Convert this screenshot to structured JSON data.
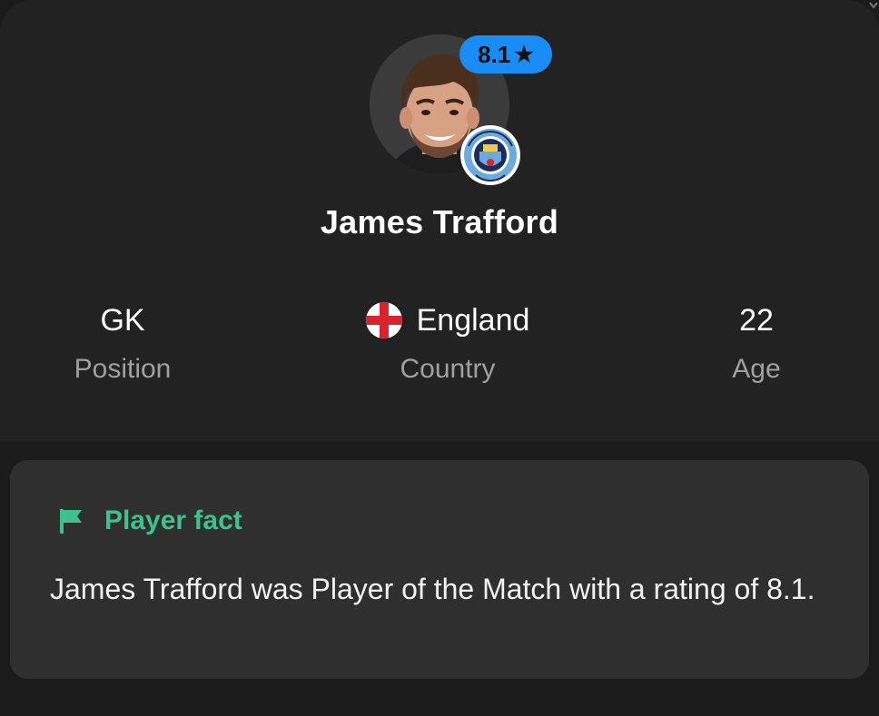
{
  "player": {
    "name": "James Trafford",
    "rating": "8.1",
    "club_badge_icon": "manchester-city-crest"
  },
  "stats": {
    "position": {
      "value": "GK",
      "label": "Position"
    },
    "country": {
      "value": "England",
      "label": "Country",
      "flag_icon": "england-flag"
    },
    "age": {
      "value": "22",
      "label": "Age"
    }
  },
  "fact": {
    "title": "Player fact",
    "text": "James Trafford was Player of the Match with a rating of 8.1.",
    "icon": "flag-icon"
  },
  "colors": {
    "background": "#1b1b1b",
    "card": "#222222",
    "fact_card": "#2f2f2f",
    "rating_badge": "#1a8cf5",
    "accent_green": "#3ec18e",
    "muted_text": "#a0a0a0"
  }
}
